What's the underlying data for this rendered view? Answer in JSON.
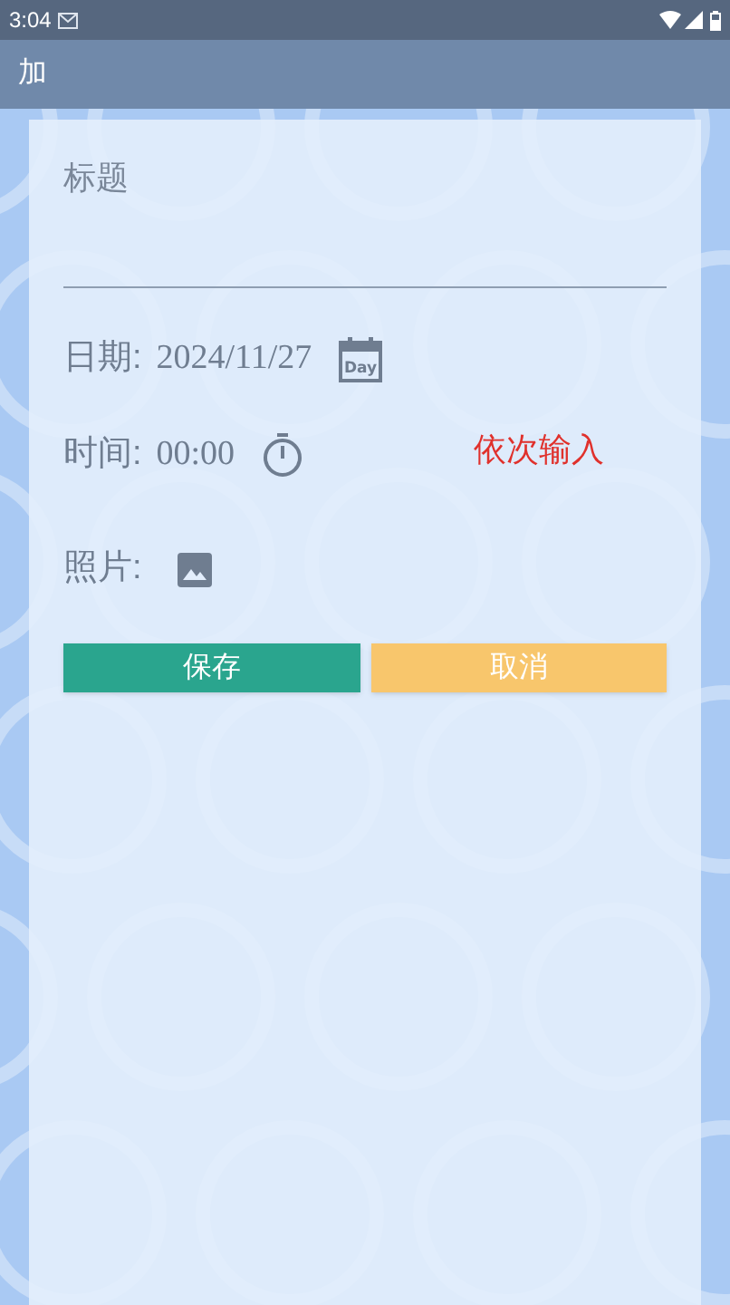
{
  "status_bar": {
    "time": "3:04"
  },
  "app_bar": {
    "title": "加"
  },
  "form": {
    "title_field": {
      "placeholder": "标题"
    },
    "date": {
      "label": "日期:",
      "value": "2024/11/27",
      "icon_text": "Day"
    },
    "time": {
      "label": "时间:",
      "value": "00:00"
    },
    "hint": "依次输入",
    "photo": {
      "label": "照片:"
    },
    "buttons": [
      {
        "label": "保存",
        "kind": "save"
      },
      {
        "label": "取消",
        "kind": "cancel"
      }
    ]
  }
}
